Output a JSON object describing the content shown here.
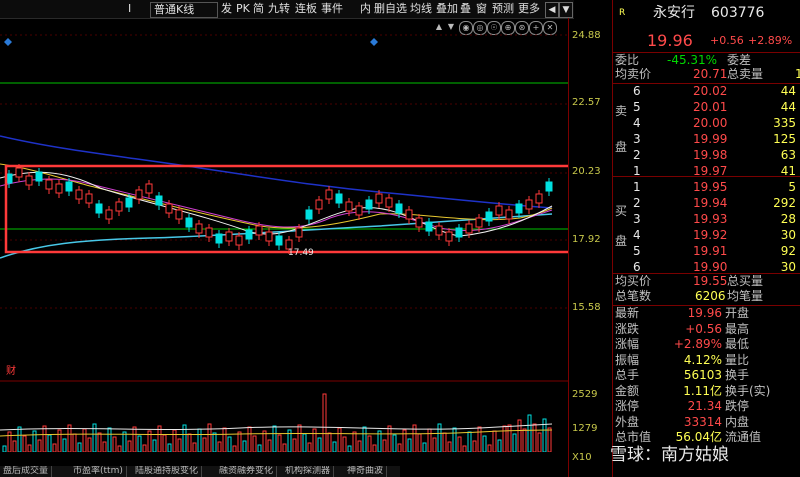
{
  "toolbar": {
    "period": "普通K线",
    "items": [
      "Ⅰ",
      "发",
      "PK",
      "简",
      "九转",
      "连板",
      "事件",
      "内",
      "删自选",
      "均线",
      "叠加",
      "叠",
      "窗",
      "预测",
      "更多"
    ],
    "tail_icons": [
      "◀",
      "▼"
    ]
  },
  "subtools": [
    "▲",
    "▼",
    "◉",
    "◎",
    "☉",
    "⊕",
    "⊛",
    "+",
    "✕"
  ],
  "price_axis": [
    "24.88",
    "22.57",
    "20.23",
    "17.92",
    "15.58"
  ],
  "volume_axis": [
    "2529",
    "1279",
    "X10"
  ],
  "chart_labels": {
    "low_marker": "17.49",
    "fin_marker": "财"
  },
  "stock": {
    "name": "永安行",
    "code": "603776",
    "tag": "R",
    "price": "19.96",
    "change": "+0.56",
    "change_pct": "+2.89%"
  },
  "weibi": {
    "label": "委比",
    "value": "-45.31%",
    "label2": "委差"
  },
  "junmai": {
    "label": "均卖价",
    "value": "20.71",
    "label2": "总卖量",
    "value2": "1"
  },
  "sell": [
    {
      "lvl": "6",
      "price": "20.02",
      "vol": "44"
    },
    {
      "lvl": "5",
      "price": "20.01",
      "vol": "44"
    },
    {
      "lvl": "4",
      "price": "20.00",
      "vol": "335"
    },
    {
      "lvl": "3",
      "price": "19.99",
      "vol": "125"
    },
    {
      "lvl": "2",
      "price": "19.98",
      "vol": "63"
    },
    {
      "lvl": "1",
      "price": "19.97",
      "vol": "41"
    }
  ],
  "buy": [
    {
      "lvl": "1",
      "price": "19.95",
      "vol": "5"
    },
    {
      "lvl": "2",
      "price": "19.94",
      "vol": "292"
    },
    {
      "lvl": "3",
      "price": "19.93",
      "vol": "28"
    },
    {
      "lvl": "4",
      "price": "19.92",
      "vol": "30"
    },
    {
      "lvl": "5",
      "price": "19.91",
      "vol": "92"
    },
    {
      "lvl": "6",
      "price": "19.90",
      "vol": "30"
    }
  ],
  "side_labels": {
    "sell": [
      "卖",
      "盘"
    ],
    "buy": [
      "买",
      "盘"
    ]
  },
  "junmaijia": {
    "label": "均买价",
    "value": "19.55",
    "label2": "总买量"
  },
  "bishu": {
    "label": "总笔数",
    "value": "6206",
    "label2": "均笔量"
  },
  "stats": [
    {
      "l": "最新",
      "v": "19.96",
      "c": "red",
      "l2": "开盘"
    },
    {
      "l": "涨跌",
      "v": "+0.56",
      "c": "red",
      "l2": "最高"
    },
    {
      "l": "涨幅",
      "v": "+2.89%",
      "c": "red",
      "l2": "最低"
    },
    {
      "l": "振幅",
      "v": "4.12%",
      "c": "yel",
      "l2": "量比"
    },
    {
      "l": "总手",
      "v": "56103",
      "c": "yel",
      "l2": "换手"
    },
    {
      "l": "金额",
      "v": "1.11亿",
      "c": "yel",
      "l2": "换手(实)"
    },
    {
      "l": "涨停",
      "v": "21.34",
      "c": "red",
      "l2": "跌停"
    },
    {
      "l": "外盘",
      "v": "33314",
      "c": "red",
      "l2": "内盘"
    },
    {
      "l": "总市值",
      "v": "56.04亿",
      "c": "yel",
      "l2": "流通值"
    }
  ],
  "tabs": [
    "盘后成交量",
    "市盈率(ttm)",
    "陆股通持股变化",
    "融资融券变化",
    "机构探测器",
    "神奇曲波"
  ],
  "watermark": "雪球：南方姑娘"
}
